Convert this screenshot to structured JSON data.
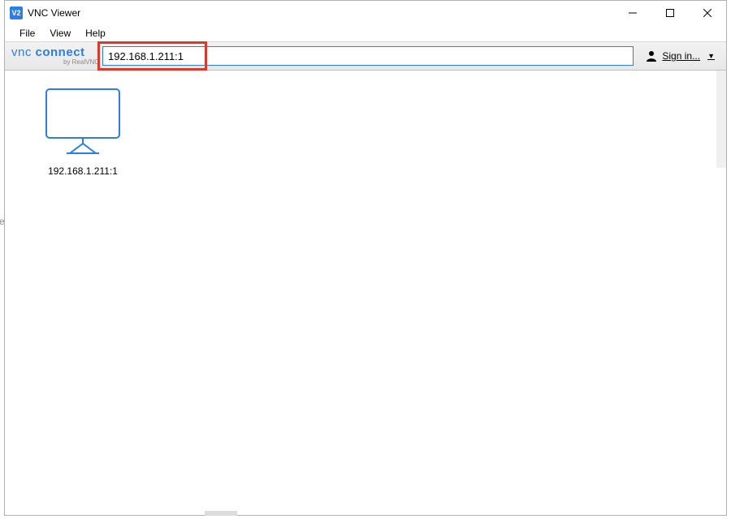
{
  "window": {
    "title": "VNC Viewer",
    "icon_label": "V2"
  },
  "menu": {
    "file": "File",
    "view": "View",
    "help": "Help"
  },
  "toolbar": {
    "brand_thin": "vnc ",
    "brand_bold": "connect",
    "brand_sub": "by RealVNC",
    "address_value": "192.168.1.211:1",
    "signin_label": "Sign in..."
  },
  "connections": [
    {
      "label": "192.168.1.211:1"
    }
  ]
}
